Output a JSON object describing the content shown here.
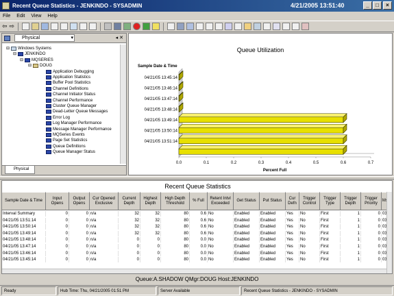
{
  "window": {
    "title": "Recent Queue Statistics - JENKINDO - SYSADMIN",
    "date": "4/21/2005 13:51:40",
    "buttons": [
      "_",
      "□",
      "×"
    ]
  },
  "menu": [
    "File",
    "Edit",
    "View",
    "Help"
  ],
  "nav": {
    "selector": "Physical",
    "tree": [
      {
        "label": "Windows Systems",
        "level": 0,
        "icon": "monitor-icon"
      },
      {
        "label": "JENKINDO",
        "level": 1,
        "icon": "server-icon"
      },
      {
        "label": "MQSERIES",
        "level": 2,
        "icon": "folder-icon"
      },
      {
        "label": "DOUG",
        "level": 3,
        "icon": "queue-manager-icon"
      },
      {
        "label": "Application Debugging",
        "level": 4,
        "icon": "workspace-icon"
      },
      {
        "label": "Application Statistics",
        "level": 4,
        "icon": "workspace-icon"
      },
      {
        "label": "Buffer Pool Statistics",
        "level": 4,
        "icon": "workspace-icon"
      },
      {
        "label": "Channel Definitions",
        "level": 4,
        "icon": "workspace-icon"
      },
      {
        "label": "Channel Initiator Status",
        "level": 4,
        "icon": "workspace-icon"
      },
      {
        "label": "Channel Performance",
        "level": 4,
        "icon": "workspace-icon"
      },
      {
        "label": "Cluster Queue Manager",
        "level": 4,
        "icon": "workspace-icon"
      },
      {
        "label": "Dead-Letter Queue Messages",
        "level": 4,
        "icon": "workspace-icon"
      },
      {
        "label": "Error Log",
        "level": 4,
        "icon": "workspace-icon"
      },
      {
        "label": "Log Manager Performance",
        "level": 4,
        "icon": "workspace-icon"
      },
      {
        "label": "Message Manager Performance",
        "level": 4,
        "icon": "workspace-icon"
      },
      {
        "label": "MQSeries Events",
        "level": 4,
        "icon": "workspace-icon"
      },
      {
        "label": "Page Set Statistics",
        "level": 4,
        "icon": "workspace-icon"
      },
      {
        "label": "Queue Definitions",
        "level": 4,
        "icon": "workspace-icon"
      },
      {
        "label": "Queue Manager Status",
        "level": 4,
        "icon": "workspace-icon"
      }
    ],
    "tab": "Physical"
  },
  "chart_data": {
    "type": "bar",
    "orientation": "horizontal",
    "title": "Queue Utilization",
    "ylabel": "Sample Date & Time",
    "xlabel": "Percent Full",
    "categories": [
      "04/21/05 13:45:14",
      "04/21/05 13:46:14",
      "04/21/05 13:47:14",
      "04/21/05 13:48:14",
      "04/21/05 13:49:14",
      "04/21/05 13:50:14",
      "04/21/05 13:51:14"
    ],
    "values": [
      0,
      0,
      0,
      0,
      0.6,
      0.6,
      0.6
    ],
    "xlim": [
      0,
      0.7
    ],
    "xticks": [
      "0.0",
      "0.1",
      "0.2",
      "0.3",
      "0.4",
      "0.5",
      "0.6",
      "0.7"
    ],
    "bar_color": "#e8e000",
    "extra_bar_value": 0.6
  },
  "table": {
    "title": "Recent Queue Statistics",
    "columns": [
      "Sample Date & Time",
      "Input Opens",
      "Output Opens",
      "Cur Opened Exclusive",
      "Current Depth",
      "Highest Depth",
      "High Depth Threshold",
      "% Full",
      "Retent Intvl Exceeded",
      "Get Status",
      "Put Status",
      "Cur Defn",
      "Trigger Control",
      "Trigger Type",
      "Trigger Depth",
      "Trigger Priority",
      "Msg"
    ],
    "rows": [
      [
        "Interval Summary",
        "0",
        "0",
        "n/a",
        "32",
        "32",
        "80",
        "0.6",
        "No",
        "Enabled",
        "Enabled",
        "Yes",
        "No",
        "First",
        "1",
        "0",
        "03"
      ],
      [
        "04/21/05 13:51:14",
        "0",
        "0",
        "n/a",
        "32",
        "32",
        "80",
        "0.6",
        "No",
        "Enabled",
        "Enabled",
        "Yes",
        "No",
        "First",
        "1",
        "0",
        "03"
      ],
      [
        "04/21/05 13:50:14",
        "0",
        "0",
        "n/a",
        "32",
        "32",
        "80",
        "0.6",
        "No",
        "Enabled",
        "Enabled",
        "Yes",
        "No",
        "First",
        "1",
        "0",
        "03"
      ],
      [
        "04/21/05 13:49:14",
        "0",
        "0",
        "n/a",
        "32",
        "32",
        "80",
        "0.6",
        "No",
        "Enabled",
        "Enabled",
        "Yes",
        "No",
        "First",
        "1",
        "0",
        "03"
      ],
      [
        "04/21/05 13:48:14",
        "0",
        "0",
        "n/a",
        "0",
        "0",
        "80",
        "0.0",
        "No",
        "Enabled",
        "Enabled",
        "Yes",
        "No",
        "First",
        "1",
        "0",
        "03"
      ],
      [
        "04/21/05 13:47:14",
        "0",
        "0",
        "n/a",
        "0",
        "0",
        "80",
        "0.0",
        "No",
        "Enabled",
        "Enabled",
        "Yes",
        "No",
        "First",
        "1",
        "0",
        "03"
      ],
      [
        "04/21/05 13:46:14",
        "0",
        "0",
        "n/a",
        "0",
        "0",
        "80",
        "0.0",
        "No",
        "Enabled",
        "Enabled",
        "Yes",
        "No",
        "First",
        "1",
        "0",
        "03"
      ],
      [
        "04/21/05 13:45:14",
        "0",
        "0",
        "n/a",
        "0",
        "0",
        "80",
        "0.0",
        "No",
        "Enabled",
        "Enabled",
        "Yes",
        "No",
        "First",
        "1",
        "0",
        "03"
      ]
    ]
  },
  "info": "Queue:A.SHADOW   QMgr:DOUG   Host:JENKINDO",
  "status": {
    "ready": "Ready",
    "hub": "Hub Time: Thu, 04/21/2005 01:51 PM",
    "server": "Server Available",
    "workspace": "Recent Queue Statistics - JENKINDO - SYSADMIN"
  }
}
